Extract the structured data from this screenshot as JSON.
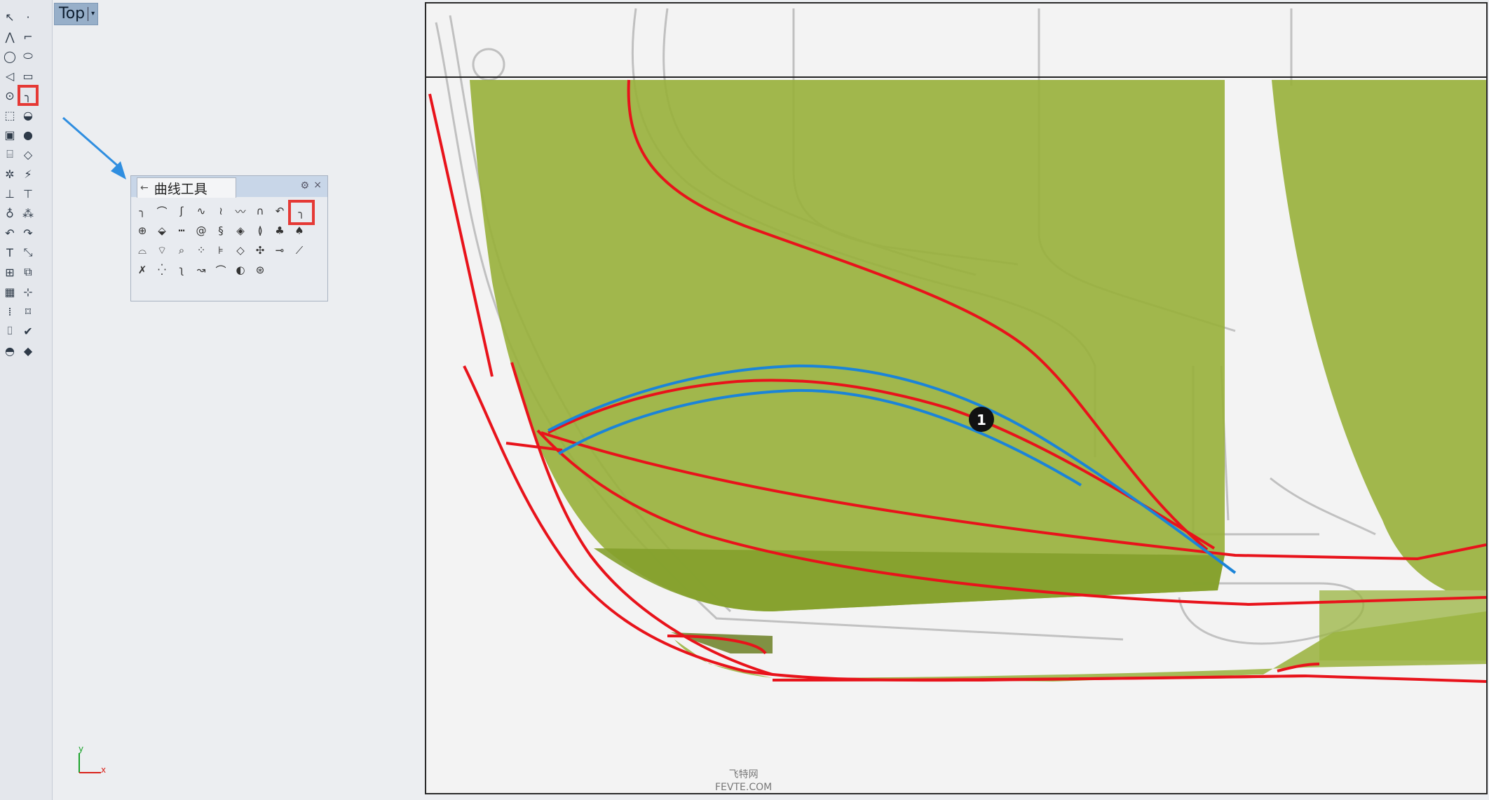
{
  "viewport": {
    "name": "Top"
  },
  "panel": {
    "title": "曲线工具"
  },
  "annotation": {
    "marker": "1"
  },
  "axis": {
    "y": "y",
    "x": "x"
  },
  "watermark": {
    "line1": "飞特网",
    "line2": "FEVTE.COM"
  },
  "colors": {
    "surface": "#98b03a",
    "curve_red": "#e8131b",
    "curve_blue": "#1b84d8",
    "highlight": "#e53935",
    "arrow": "#2f8ee0"
  }
}
